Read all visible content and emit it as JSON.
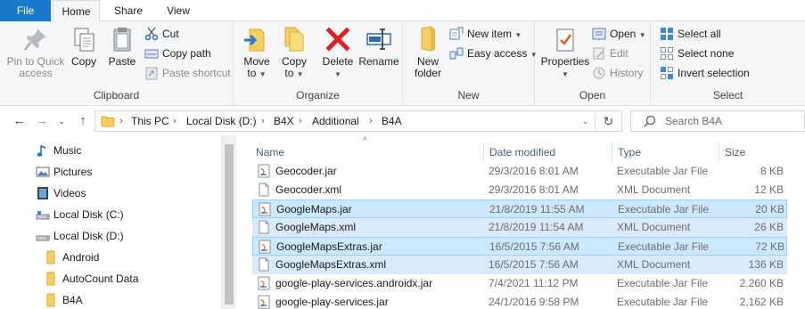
{
  "ribbon_tabs": {
    "file": "File",
    "home": "Home",
    "share": "Share",
    "view": "View"
  },
  "clipboard": {
    "label": "Clipboard",
    "pin": "Pin to Quick access",
    "pin_l1": "Pin to Quick",
    "pin_l2": "access",
    "copy": "Copy",
    "paste": "Paste",
    "cut": "Cut",
    "copy_path": "Copy path",
    "paste_shortcut": "Paste shortcut"
  },
  "organize": {
    "label": "Organize",
    "move_to": "Move",
    "move_to_l2": "to",
    "copy_to": "Copy",
    "copy_to_l2": "to",
    "delete": "Delete",
    "rename": "Rename"
  },
  "new_group": {
    "label": "New",
    "new_folder_l1": "New",
    "new_folder_l2": "folder",
    "new_item": "New item",
    "easy_access": "Easy access"
  },
  "open_group": {
    "label": "Open",
    "properties": "Properties",
    "open": "Open",
    "edit": "Edit",
    "history": "History"
  },
  "select_group": {
    "label": "Select",
    "select_all": "Select all",
    "select_none": "Select none",
    "invert_selection": "Invert selection"
  },
  "breadcrumb": [
    "This PC",
    "Local Disk (D:)",
    "B4X",
    "Additional",
    "B4A"
  ],
  "search": {
    "placeholder": "Search B4A"
  },
  "nav_items": [
    {
      "label": "Music",
      "icon": "music-icon"
    },
    {
      "label": "Pictures",
      "icon": "pictures-icon"
    },
    {
      "label": "Videos",
      "icon": "videos-icon"
    },
    {
      "label": "Local Disk (C:)",
      "icon": "drive-icon"
    },
    {
      "label": "Local Disk (D:)",
      "icon": "drive-icon"
    },
    {
      "label": "Android",
      "icon": "folder-icon"
    },
    {
      "label": "AutoCount Data",
      "icon": "folder-icon"
    },
    {
      "label": "B4A",
      "icon": "folder-icon"
    }
  ],
  "columns": {
    "name": "Name",
    "date": "Date modified",
    "type": "Type",
    "size": "Size"
  },
  "files": [
    {
      "name": "Geocoder.jar",
      "date": "29/3/2016 8:01 AM",
      "type": "Executable Jar File",
      "size": "8 KB",
      "kind": "jar",
      "selected": false
    },
    {
      "name": "Geocoder.xml",
      "date": "29/3/2016 8:01 AM",
      "type": "XML Document",
      "size": "12 KB",
      "kind": "xml",
      "selected": false
    },
    {
      "name": "GoogleMaps.jar",
      "date": "21/8/2019 11:55 AM",
      "type": "Executable Jar File",
      "size": "20 KB",
      "kind": "jar",
      "selected": true
    },
    {
      "name": "GoogleMaps.xml",
      "date": "21/8/2019 11:54 AM",
      "type": "XML Document",
      "size": "26 KB",
      "kind": "xml",
      "selected": true
    },
    {
      "name": "GoogleMapsExtras.jar",
      "date": "16/5/2015 7:56 AM",
      "type": "Executable Jar File",
      "size": "72 KB",
      "kind": "jar",
      "selected": true
    },
    {
      "name": "GoogleMapsExtras.xml",
      "date": "16/5/2015 7:56 AM",
      "type": "XML Document",
      "size": "136 KB",
      "kind": "xml",
      "selected": true
    },
    {
      "name": "google-play-services.androidx.jar",
      "date": "7/4/2021 11:12 PM",
      "type": "Executable Jar File",
      "size": "2,260 KB",
      "kind": "jar",
      "selected": false
    },
    {
      "name": "google-play-services.jar",
      "date": "24/1/2016 9:58 PM",
      "type": "Executable Jar File",
      "size": "2,162 KB",
      "kind": "jar",
      "selected": false
    }
  ],
  "colors": {
    "accent": "#1979ca",
    "selection": "#cce8ff",
    "selection_border": "#99d1ff",
    "folder": "#f6cf5e"
  }
}
